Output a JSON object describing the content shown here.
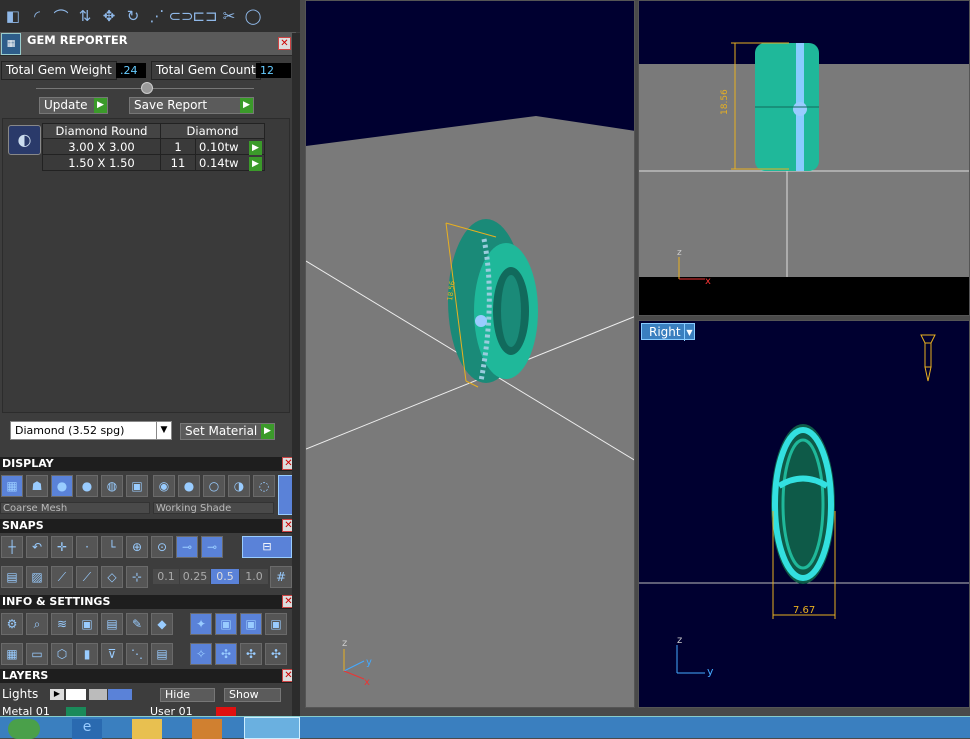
{
  "toolbar": {
    "icons": [
      "cube-icon",
      "arc-icon",
      "curve-icon",
      "mirror-icon",
      "move-icon",
      "rotate-icon",
      "fan-icon",
      "link-icon",
      "unlink-icon",
      "scissors-icon",
      "circle-icon"
    ]
  },
  "gem_reporter": {
    "title": "GEM REPORTER",
    "total_weight_label": "Total Gem Weight",
    "total_weight": ".24",
    "total_count_label": "Total Gem Count",
    "total_count": "12",
    "update": "Update",
    "save_report": "Save Report",
    "col1": "Diamond Round",
    "col2": "Diamond",
    "rows": [
      {
        "size": "3.00 X 3.00",
        "qty": "1",
        "wt": "0.10tw"
      },
      {
        "size": "1.50 X 1.50",
        "qty": "11",
        "wt": "0.14tw"
      }
    ],
    "material": "Diamond    (3.52 spg)",
    "set_material": "Set Material"
  },
  "display": {
    "title": "DISPLAY",
    "mesh": "Coarse Mesh",
    "shade": "Working Shade"
  },
  "snaps": {
    "title": "SNAPS",
    "steps": [
      "0.1",
      "0.25",
      "0.5",
      "1.0"
    ]
  },
  "info": {
    "title": "INFO & SETTINGS"
  },
  "layers": {
    "title": "LAYERS",
    "lights": "Lights",
    "hide": "Hide",
    "show": "Show",
    "metal": "Metal 01",
    "user": "User 01"
  },
  "viewports": {
    "front_dim": "18.56",
    "persp_dim": "18.56",
    "right_label": "Right",
    "right_dim": "7.67",
    "axis_z": "z",
    "axis_x": "x",
    "axis_y": "y"
  },
  "colors": {
    "ring": "#1fb89a",
    "glow": "#33e0e0",
    "dim": "#e8b020"
  }
}
